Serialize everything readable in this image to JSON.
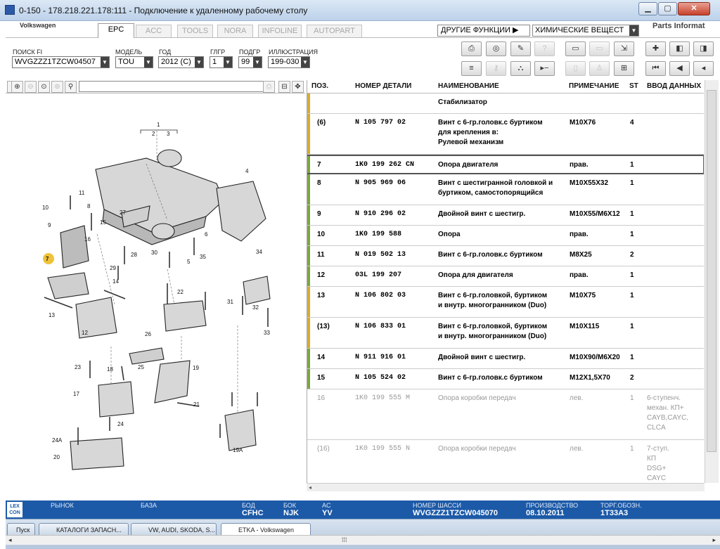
{
  "window": {
    "title": "0-150 - 178.218.221.178:111 - Подключение к удаленному рабочему столу"
  },
  "app": {
    "brand": "Volkswagen",
    "tabs": [
      "EPC",
      "ACC",
      "TOOLS",
      "NORA",
      "INFOLINE",
      "AUTOPART"
    ],
    "active_tab": "EPC",
    "other_functions": "ДРУГИЕ ФУНКЦИИ",
    "chem_selector": "ХИМИЧЕСКИЕ ВЕЩЕСТ",
    "parts_info": "Parts Informat"
  },
  "filters": {
    "search_fi": {
      "label": "ПОИСК FI",
      "value": "WVGZZZ1TZCW04507"
    },
    "model": {
      "label": "МОДЕЛЬ",
      "value": "TOU"
    },
    "year": {
      "label": "ГОД",
      "value": "2012 (C)"
    },
    "glgr": {
      "label": "ГЛГР",
      "value": "1"
    },
    "podgr": {
      "label": "ПОДГР",
      "value": "99"
    },
    "illustration": {
      "label": "ИЛЛЮСТРАЦИЯ",
      "value": "199-030"
    }
  },
  "toolbar": {
    "row1": [
      {
        "icon": "printer-icon",
        "glyph": "⎙",
        "enabled": true
      },
      {
        "icon": "disc-icon",
        "glyph": "◎",
        "enabled": true
      },
      {
        "icon": "price-tag-icon",
        "glyph": "✎",
        "enabled": true
      },
      {
        "icon": "help-icon",
        "glyph": "?",
        "enabled": false
      },
      {
        "icon": "elsa-icon",
        "glyph": "▭",
        "enabled": true
      },
      {
        "icon": "depot-icon",
        "glyph": "▭",
        "enabled": false
      },
      {
        "icon": "cart-arrow-icon",
        "glyph": "⇲",
        "enabled": true
      },
      {
        "icon": "pin-icon",
        "glyph": "✚",
        "enabled": true
      },
      {
        "icon": "back-list-icon",
        "glyph": "◧",
        "enabled": true
      },
      {
        "icon": "next-list-icon",
        "glyph": "◨",
        "enabled": true
      }
    ],
    "row2": [
      {
        "icon": "list-icon",
        "glyph": "≡",
        "enabled": true
      },
      {
        "icon": "key-icon",
        "glyph": "⚷",
        "enabled": false
      },
      {
        "icon": "vehicle-icon",
        "glyph": "⛬",
        "enabled": true
      },
      {
        "icon": "play-minus-icon",
        "glyph": "▸−",
        "enabled": true
      },
      {
        "icon": "phone-icon",
        "glyph": "▯",
        "enabled": false
      },
      {
        "icon": "people-icon",
        "glyph": "♙",
        "enabled": false
      },
      {
        "icon": "cart-icon",
        "glyph": "⊞",
        "enabled": true
      },
      {
        "icon": "first-icon",
        "glyph": "⏮",
        "enabled": true
      },
      {
        "icon": "prev-icon",
        "glyph": "◀",
        "enabled": true
      },
      {
        "icon": "back-icon",
        "glyph": "◂",
        "enabled": true
      }
    ]
  },
  "viewer": {
    "tools": [
      "zoom-in-icon",
      "zoom-out-icon",
      "zoom-fit-icon",
      "zoom-area-icon",
      "magnifier-icon"
    ],
    "right_tools": [
      "print-view-icon",
      "split-view-icon",
      "move-icon"
    ],
    "callouts": [
      "1",
      "2",
      "3",
      "4",
      "5",
      "6",
      "7",
      "8",
      "9",
      "10",
      "11",
      "12",
      "13",
      "14",
      "15",
      "16",
      "17",
      "18",
      "19",
      "19A",
      "20",
      "21",
      "22",
      "23",
      "24",
      "24A",
      "25",
      "26",
      "27",
      "28",
      "29",
      "30",
      "31",
      "32",
      "33",
      "34",
      "35"
    ],
    "highlighted": "7"
  },
  "table": {
    "headers": {
      "pos": "ПОЗ.",
      "part": "НОМЕР ДЕТАЛИ",
      "name": "НАИМЕНОВАНИЕ",
      "note": "ПРИМЕЧАНИЕ",
      "st": "ST",
      "data": "ВВОД ДАННЫХ"
    },
    "rows": [
      {
        "pos": "",
        "part": "",
        "name": "Стабилизатор",
        "note": "",
        "st": "",
        "data": "",
        "color": "#d8aa2e",
        "style": "normal"
      },
      {
        "pos": "(6)",
        "part": "N     105 797 02",
        "name": "Винт с 6-гр.головк.с буртиком\n          для крепления в:\nРулевой механизм",
        "note": "M10X76",
        "st": "4",
        "data": "",
        "color": "#d8aa2e",
        "style": "normal"
      },
      {
        "pos": "7",
        "part": "1K0 199 262 CN",
        "name": "Опора двигателя",
        "note": "прав.",
        "st": "1",
        "data": "",
        "color": "#7da63c",
        "style": "sel"
      },
      {
        "pos": "8",
        "part": "N     905 969 06",
        "name": "Винт с шестигранной головкой и\nбуртиком, самостопорящийся",
        "note": "M10X55X32",
        "st": "1",
        "data": "",
        "color": "#7da63c",
        "style": "normal"
      },
      {
        "pos": "9",
        "part": "N     910 296 02",
        "name": "Двойной винт с шестигр.",
        "note": "M10X55/M6X12",
        "st": "1",
        "data": "",
        "color": "#7da63c",
        "style": "normal"
      },
      {
        "pos": "10",
        "part": "1K0 199 588",
        "name": "Опора",
        "note": "прав.",
        "st": "1",
        "data": "",
        "color": "#7da63c",
        "style": "normal"
      },
      {
        "pos": "11",
        "part": "N     019 502 13",
        "name": "Винт с 6-гр.головк.с буртиком",
        "note": "M8X25",
        "st": "2",
        "data": "",
        "color": "#7da63c",
        "style": "normal"
      },
      {
        "pos": "12",
        "part": "03L 199 207",
        "name": "Опора для двигателя",
        "note": "прав.",
        "st": "1",
        "data": "",
        "color": "#7da63c",
        "style": "normal"
      },
      {
        "pos": "13",
        "part": "N     106 802 03",
        "name": "Винт с 6-гр.головкой, буртиком\nи внутр. многогранником (Duo)",
        "note": "M10X75",
        "st": "1",
        "data": "",
        "color": "#d8aa2e",
        "style": "normal"
      },
      {
        "pos": "(13)",
        "part": "N     106 833 01",
        "name": "Винт с 6-гр.головкой, буртиком\nи внутр. многогранником (Duo)",
        "note": "M10X115",
        "st": "1",
        "data": "",
        "color": "#d8aa2e",
        "style": "normal"
      },
      {
        "pos": "14",
        "part": "N     911 916 01",
        "name": "Двойной винт с шестигр.",
        "note": "M10X90/M6X20",
        "st": "1",
        "data": "",
        "color": "#7da63c",
        "style": "normal"
      },
      {
        "pos": "15",
        "part": "N     105 524 02",
        "name": "Винт с 6-гр.головк.с буртиком",
        "note": "M12X1,5X70",
        "st": "2",
        "data": "",
        "color": "#7da63c",
        "style": "normal"
      },
      {
        "pos": "16",
        "part": "1K0 199 555 M",
        "name": "Опора коробки передач",
        "note": "лев.",
        "st": "1",
        "data": "6-ступенч.\nмехан. КП+\nCAYB,CAYC,\nCLCA",
        "color": "#ffffff",
        "style": "gray"
      },
      {
        "pos": "(16)",
        "part": "1K0 199 555 N",
        "name": "Опора коробки передач",
        "note": "лев.",
        "st": "1",
        "data": "7-ступ.\nКП\nDSG+\nCAYC",
        "color": "#ffffff",
        "style": "gray"
      }
    ]
  },
  "status": {
    "market": {
      "label": "РЫНОК",
      "value": ""
    },
    "bz": {
      "label": "БАЗА",
      "value": ""
    },
    "bod": {
      "label": "БОД",
      "value": "CFHC"
    },
    "bok": {
      "label": "БОК",
      "value": "NJK"
    },
    "ac": {
      "label": "AC",
      "value": "YV"
    },
    "chassis": {
      "label": "НОМЕР ШАССИ",
      "value": "WVGZZZ1TZCW045070"
    },
    "production": {
      "label": "ПРОИЗВОДСТВО",
      "value": "08.10.2011"
    },
    "torg": {
      "label": "ТОРГ.ОБОЗН.",
      "value": "1T33A3"
    },
    "lexcon": "LEX CON"
  },
  "taskbar": {
    "items": [
      "Пуск",
      "КАТАЛОГИ ЗАПАСН...",
      "VW, AUDI, SKODA, S...",
      "ETKA - Volkswagen"
    ]
  }
}
